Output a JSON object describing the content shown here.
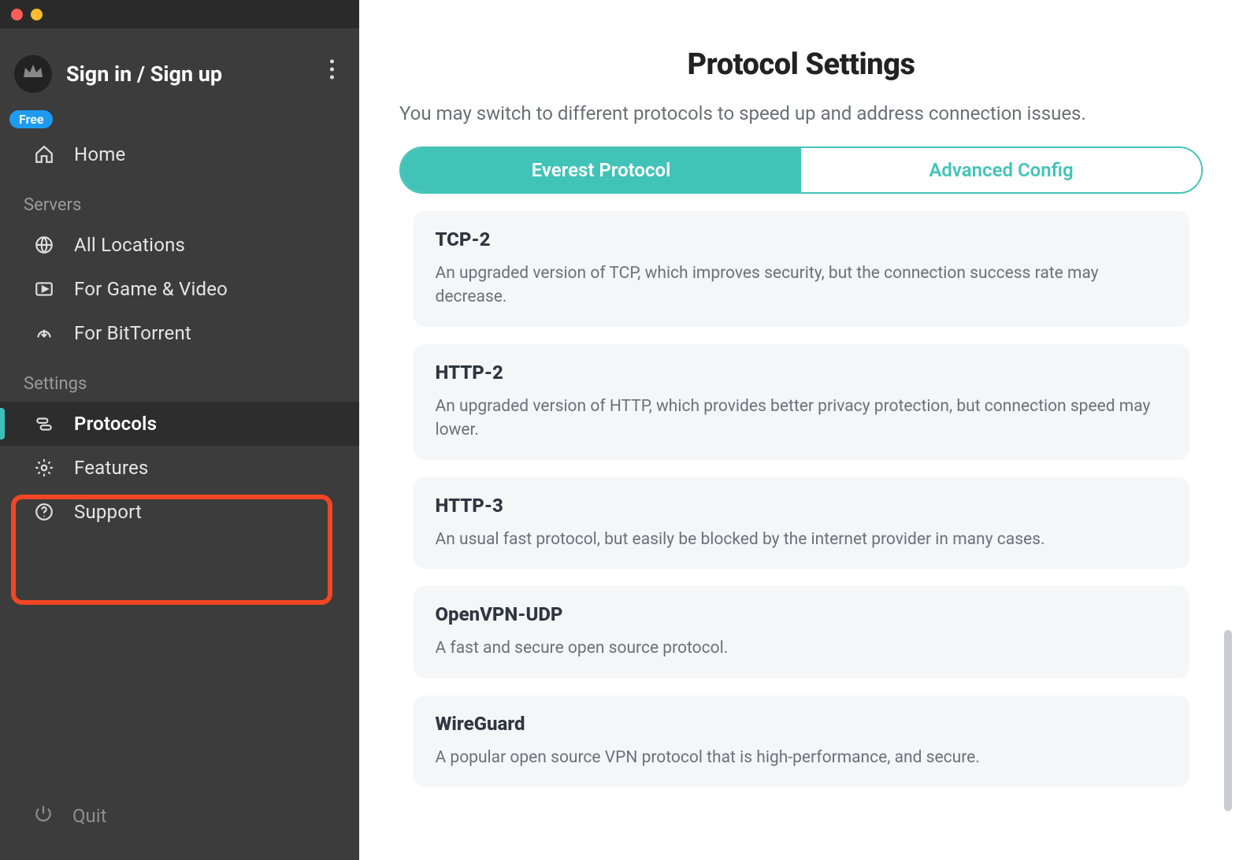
{
  "titlebar": {
    "close": "close",
    "min": "minimize"
  },
  "account": {
    "signin_label": "Sign in / Sign up",
    "badge": "Free"
  },
  "sidebar": {
    "home_label": "Home",
    "sections": {
      "servers_label": "Servers",
      "settings_label": "Settings"
    },
    "items": {
      "all_locations": "All Locations",
      "game_video": "For Game & Video",
      "bittorrent": "For BitTorrent",
      "protocols": "Protocols",
      "features": "Features",
      "support": "Support"
    },
    "quit_label": "Quit"
  },
  "main": {
    "title": "Protocol Settings",
    "subtitle": "You may switch to different protocols to speed up and address connection issues.",
    "tabs": {
      "everest": "Everest Protocol",
      "advanced": "Advanced Config"
    },
    "protocols": [
      {
        "name": "TCP-2",
        "desc": "An upgraded version of TCP, which improves security, but the connection success rate may decrease."
      },
      {
        "name": "HTTP-2",
        "desc": "An upgraded version of HTTP, which provides better privacy protection, but connection speed may lower."
      },
      {
        "name": "HTTP-3",
        "desc": "An usual fast protocol, but easily be blocked by the internet provider in many cases."
      },
      {
        "name": "OpenVPN-UDP",
        "desc": "A fast and secure open source protocol."
      },
      {
        "name": "WireGuard",
        "desc": "A popular open source VPN protocol that is high-performance, and secure."
      }
    ]
  }
}
